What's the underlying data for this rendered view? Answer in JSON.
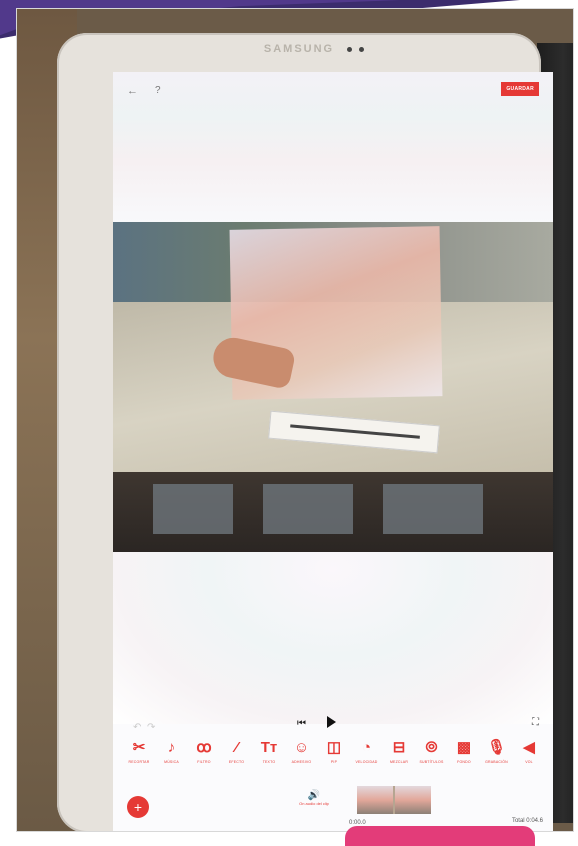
{
  "device": {
    "brand": "SAMSUNG"
  },
  "topbar": {
    "back_icon": "back-arrow-icon",
    "help_icon": "help-icon",
    "save_label": "GUARDAR"
  },
  "playback": {
    "undo_icon": "undo-icon",
    "redo_icon": "redo-icon",
    "skip_icon": "skip-to-start-icon",
    "play_icon": "play-icon",
    "fullscreen_icon": "fullscreen-icon"
  },
  "tools": [
    {
      "label": "RECORTAR",
      "icon": "scissors-icon",
      "glyph": "✂"
    },
    {
      "label": "MÚSICA",
      "icon": "music-icon",
      "glyph": "♪"
    },
    {
      "label": "FILTRO",
      "icon": "filter-icon",
      "glyph": "ꝏ"
    },
    {
      "label": "EFECTO",
      "icon": "effect-icon",
      "glyph": "⁄"
    },
    {
      "label": "TEXTO",
      "icon": "text-icon",
      "glyph": "Tт"
    },
    {
      "label": "ADHESIVO",
      "icon": "sticker-icon",
      "glyph": "☺"
    },
    {
      "label": "PIP",
      "icon": "pip-icon",
      "glyph": "◫"
    },
    {
      "label": "VELOCIDAD",
      "icon": "speed-icon",
      "glyph": "◔"
    },
    {
      "label": "MEZCLAR",
      "icon": "blend-icon",
      "glyph": "⊟"
    },
    {
      "label": "SUBTÍTULOS",
      "icon": "subtitles-icon",
      "glyph": "⦾"
    },
    {
      "label": "FONDO",
      "icon": "background-icon",
      "glyph": "▩"
    },
    {
      "label": "GRABACIÓN",
      "icon": "microphone-icon",
      "glyph": "🎙"
    },
    {
      "label": "VOL",
      "icon": "volume-icon",
      "glyph": "◀"
    }
  ],
  "timeline": {
    "add_icon": "plus-icon",
    "audio_label": "On audio del clip",
    "audio_icon": "speaker-icon",
    "current_time": "0:00.0",
    "total": "Total 0:04.6"
  },
  "colors": {
    "accent": "#e53935"
  }
}
